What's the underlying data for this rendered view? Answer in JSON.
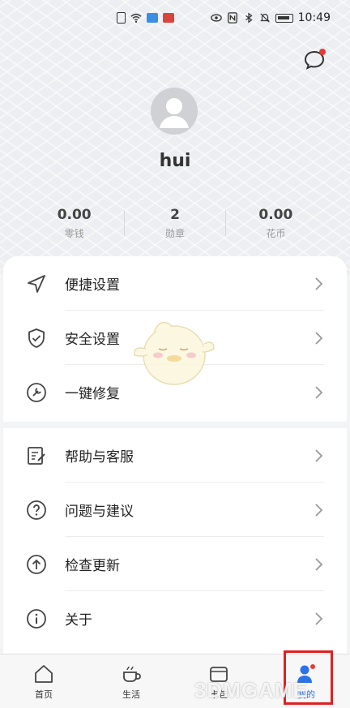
{
  "status_bar": {
    "time": "10:49"
  },
  "profile": {
    "username": "hui"
  },
  "stats": [
    {
      "value": "0.00",
      "label": "零钱"
    },
    {
      "value": "2",
      "label": "勋章"
    },
    {
      "value": "0.00",
      "label": "花币"
    }
  ],
  "menu_group_1": [
    {
      "label": "便捷设置",
      "icon": "navigation-arrow-icon"
    },
    {
      "label": "安全设置",
      "icon": "shield-check-icon"
    },
    {
      "label": "一键修复",
      "icon": "repair-icon"
    }
  ],
  "menu_group_2": [
    {
      "label": "帮助与客服",
      "icon": "edit-help-icon"
    },
    {
      "label": "问题与建议",
      "icon": "question-circle-icon"
    },
    {
      "label": "检查更新",
      "icon": "upload-circle-icon"
    },
    {
      "label": "关于",
      "icon": "info-circle-icon"
    }
  ],
  "bottom_nav": [
    {
      "label": "首页",
      "icon": "home-icon"
    },
    {
      "label": "生活",
      "icon": "coffee-cup-icon"
    },
    {
      "label": "卡包",
      "icon": "card-bag-icon"
    },
    {
      "label": "我的",
      "icon": "user-icon"
    }
  ],
  "watermark": "3DMGAME",
  "colors": {
    "accent": "#2a72e8",
    "badge": "#e83a3a",
    "highlight": "#e02020"
  }
}
